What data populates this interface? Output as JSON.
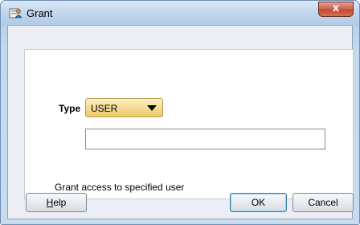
{
  "window": {
    "title": "Grant",
    "close_label": "x",
    "title_icon": "grant-window-icon"
  },
  "form": {
    "type_label": "Type",
    "type_value": "USER",
    "name_value": "",
    "description": "Grant access to specified user"
  },
  "buttons": {
    "help_mnemonic": "H",
    "help_rest": "elp",
    "ok": "OK",
    "cancel": "Cancel"
  }
}
